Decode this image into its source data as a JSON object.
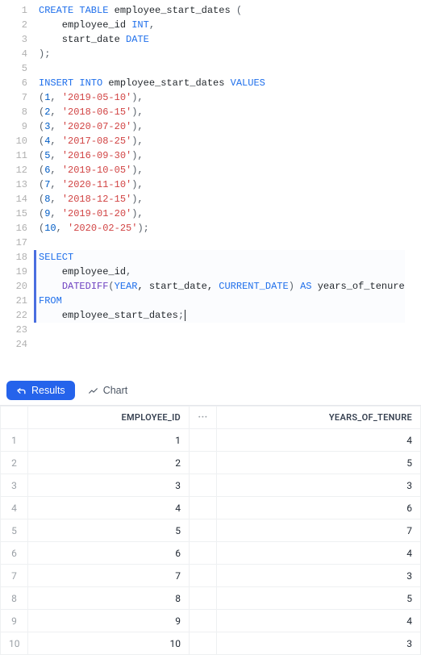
{
  "editor": {
    "lines": [
      {
        "n": 1,
        "tokens": [
          {
            "t": "CREATE TABLE",
            "c": "kw"
          },
          {
            "t": " ",
            "c": "id"
          },
          {
            "t": "employee_start_dates",
            "c": "id"
          },
          {
            "t": " (",
            "c": "punc"
          }
        ]
      },
      {
        "n": 2,
        "tokens": [
          {
            "t": "    employee_id ",
            "c": "id"
          },
          {
            "t": "INT",
            "c": "type"
          },
          {
            "t": ",",
            "c": "punc"
          }
        ]
      },
      {
        "n": 3,
        "tokens": [
          {
            "t": "    start_date ",
            "c": "id"
          },
          {
            "t": "DATE",
            "c": "type"
          }
        ]
      },
      {
        "n": 4,
        "tokens": [
          {
            "t": ");",
            "c": "punc"
          }
        ]
      },
      {
        "n": 5,
        "tokens": []
      },
      {
        "n": 6,
        "tokens": [
          {
            "t": "INSERT INTO",
            "c": "kw"
          },
          {
            "t": " employee_start_dates ",
            "c": "id"
          },
          {
            "t": "VALUES",
            "c": "kw"
          }
        ]
      },
      {
        "n": 7,
        "tokens": [
          {
            "t": "(",
            "c": "punc"
          },
          {
            "t": "1",
            "c": "num"
          },
          {
            "t": ", ",
            "c": "punc"
          },
          {
            "t": "'2019-05-10'",
            "c": "str"
          },
          {
            "t": "),",
            "c": "punc"
          }
        ]
      },
      {
        "n": 8,
        "tokens": [
          {
            "t": "(",
            "c": "punc"
          },
          {
            "t": "2",
            "c": "num"
          },
          {
            "t": ", ",
            "c": "punc"
          },
          {
            "t": "'2018-06-15'",
            "c": "str"
          },
          {
            "t": "),",
            "c": "punc"
          }
        ]
      },
      {
        "n": 9,
        "tokens": [
          {
            "t": "(",
            "c": "punc"
          },
          {
            "t": "3",
            "c": "num"
          },
          {
            "t": ", ",
            "c": "punc"
          },
          {
            "t": "'2020-07-20'",
            "c": "str"
          },
          {
            "t": "),",
            "c": "punc"
          }
        ]
      },
      {
        "n": 10,
        "tokens": [
          {
            "t": "(",
            "c": "punc"
          },
          {
            "t": "4",
            "c": "num"
          },
          {
            "t": ", ",
            "c": "punc"
          },
          {
            "t": "'2017-08-25'",
            "c": "str"
          },
          {
            "t": "),",
            "c": "punc"
          }
        ]
      },
      {
        "n": 11,
        "tokens": [
          {
            "t": "(",
            "c": "punc"
          },
          {
            "t": "5",
            "c": "num"
          },
          {
            "t": ", ",
            "c": "punc"
          },
          {
            "t": "'2016-09-30'",
            "c": "str"
          },
          {
            "t": "),",
            "c": "punc"
          }
        ]
      },
      {
        "n": 12,
        "tokens": [
          {
            "t": "(",
            "c": "punc"
          },
          {
            "t": "6",
            "c": "num"
          },
          {
            "t": ", ",
            "c": "punc"
          },
          {
            "t": "'2019-10-05'",
            "c": "str"
          },
          {
            "t": "),",
            "c": "punc"
          }
        ]
      },
      {
        "n": 13,
        "tokens": [
          {
            "t": "(",
            "c": "punc"
          },
          {
            "t": "7",
            "c": "num"
          },
          {
            "t": ", ",
            "c": "punc"
          },
          {
            "t": "'2020-11-10'",
            "c": "str"
          },
          {
            "t": "),",
            "c": "punc"
          }
        ]
      },
      {
        "n": 14,
        "tokens": [
          {
            "t": "(",
            "c": "punc"
          },
          {
            "t": "8",
            "c": "num"
          },
          {
            "t": ", ",
            "c": "punc"
          },
          {
            "t": "'2018-12-15'",
            "c": "str"
          },
          {
            "t": "),",
            "c": "punc"
          }
        ]
      },
      {
        "n": 15,
        "tokens": [
          {
            "t": "(",
            "c": "punc"
          },
          {
            "t": "9",
            "c": "num"
          },
          {
            "t": ", ",
            "c": "punc"
          },
          {
            "t": "'2019-01-20'",
            "c": "str"
          },
          {
            "t": "),",
            "c": "punc"
          }
        ]
      },
      {
        "n": 16,
        "tokens": [
          {
            "t": "(",
            "c": "punc"
          },
          {
            "t": "10",
            "c": "num"
          },
          {
            "t": ", ",
            "c": "punc"
          },
          {
            "t": "'2020-02-25'",
            "c": "str"
          },
          {
            "t": ");",
            "c": "punc"
          }
        ]
      },
      {
        "n": 17,
        "tokens": []
      },
      {
        "n": 18,
        "hl": true,
        "tokens": [
          {
            "t": "SELECT",
            "c": "kw"
          }
        ]
      },
      {
        "n": 19,
        "hl": true,
        "tokens": [
          {
            "t": "    employee_id",
            "c": "id"
          },
          {
            "t": ",",
            "c": "punc"
          }
        ]
      },
      {
        "n": 20,
        "hl": true,
        "tokens": [
          {
            "t": "    ",
            "c": "id"
          },
          {
            "t": "DATEDIFF",
            "c": "fn"
          },
          {
            "t": "(",
            "c": "punc"
          },
          {
            "t": "YEAR",
            "c": "kw"
          },
          {
            "t": ", start_date, ",
            "c": "id"
          },
          {
            "t": "CURRENT_DATE",
            "c": "kw"
          },
          {
            "t": ") ",
            "c": "punc"
          },
          {
            "t": "AS",
            "c": "kw"
          },
          {
            "t": " years_of_tenure",
            "c": "id"
          }
        ]
      },
      {
        "n": 21,
        "hl": true,
        "tokens": [
          {
            "t": "FROM",
            "c": "kw"
          }
        ]
      },
      {
        "n": 22,
        "hl": true,
        "tokens": [
          {
            "t": "    employee_start_dates",
            "c": "id"
          },
          {
            "t": ";",
            "c": "punc"
          }
        ],
        "cursor": true
      },
      {
        "n": 23,
        "tokens": []
      },
      {
        "n": 24,
        "tokens": []
      }
    ]
  },
  "tabs": {
    "results_label": "Results",
    "chart_label": "Chart"
  },
  "table": {
    "columns": [
      "EMPLOYEE_ID",
      "YEARS_OF_TENURE"
    ],
    "ellipsis": "···",
    "rows": [
      {
        "idx": 1,
        "employee_id": 1,
        "years_of_tenure": 4
      },
      {
        "idx": 2,
        "employee_id": 2,
        "years_of_tenure": 5
      },
      {
        "idx": 3,
        "employee_id": 3,
        "years_of_tenure": 3
      },
      {
        "idx": 4,
        "employee_id": 4,
        "years_of_tenure": 6
      },
      {
        "idx": 5,
        "employee_id": 5,
        "years_of_tenure": 7
      },
      {
        "idx": 6,
        "employee_id": 6,
        "years_of_tenure": 4
      },
      {
        "idx": 7,
        "employee_id": 7,
        "years_of_tenure": 3
      },
      {
        "idx": 8,
        "employee_id": 8,
        "years_of_tenure": 5
      },
      {
        "idx": 9,
        "employee_id": 9,
        "years_of_tenure": 4
      },
      {
        "idx": 10,
        "employee_id": 10,
        "years_of_tenure": 3
      }
    ]
  }
}
